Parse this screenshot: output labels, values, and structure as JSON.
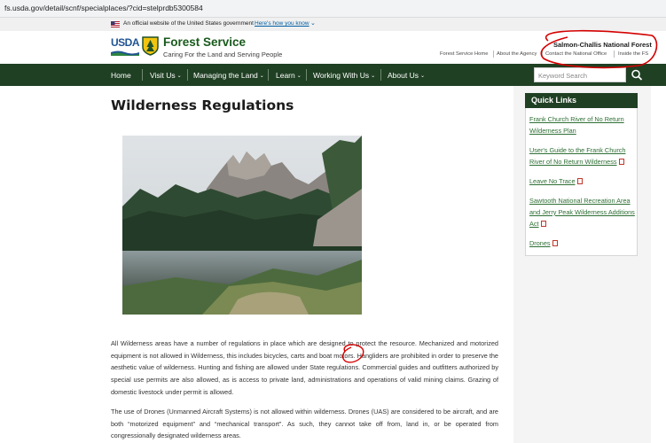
{
  "browser": {
    "url": "fs.usda.gov/detail/scnf/specialplaces/?cid=stelprdb5300584"
  },
  "gov_banner": {
    "text": "An official website of the United States government",
    "link": "Here's how you know"
  },
  "header": {
    "agency_logo_text": "USDA",
    "site_title": "Forest Service",
    "tagline": "Caring For the Land and Serving People",
    "forest_name": "Salmon-Challis National Forest",
    "utility_links": [
      "Forest Service Home",
      "About the Agency",
      "Contact the National Office",
      "Inside the FS"
    ]
  },
  "nav": {
    "items": [
      "Home",
      "Visit Us",
      "Managing the Land",
      "Learn",
      "Working With Us",
      "About Us"
    ],
    "search_placeholder": "Keyword Search"
  },
  "main": {
    "title": "Wilderness Regulations",
    "paragraphs": [
      "All Wilderness areas have a number of regulations in place which are designed to protect the resource.  Mechanized and motorized equipment is not allowed in Wilderness, this includes bicycles, carts and boat motors.  Hangliders are prohibited in order to preserve the aesthetic value of wilderness.  Hunting and fishing are allowed under State regulations.  Commercial guides and outfitters authorized by special use permits are also allowed, as is access to private land, administrations and operations of valid mining claims.  Grazing of domestic livestock under permit is allowed.",
      "The use of Drones (Unmanned Aircraft Systems) is not allowed within wilderness. Drones (UAS) are considered to be aircraft, and are both “motorized equipment” and “mechanical transport”. As such, they cannot take off from, land in, or be operated from congressionally designated wilderness areas."
    ]
  },
  "quick_links": {
    "title": "Quick Links",
    "items": [
      "Frank Church River of No Return Wilderness Plan",
      "User's Guide to the Frank Church River of No Return Wilderness",
      "Leave No Trace",
      "Sawtooth National Recreation Area and Jerry Peak Wilderness Additions Act",
      "Drones"
    ]
  },
  "colors": {
    "nav_green": "#204024",
    "title_green": "#185a1c",
    "link_green": "#2e6f34",
    "annotation_red": "#d40000"
  },
  "icons": [
    "us-flag-icon",
    "usda-logo",
    "forest-service-shield-icon",
    "search-icon",
    "pdf-icon",
    "chevron-down-icon"
  ]
}
